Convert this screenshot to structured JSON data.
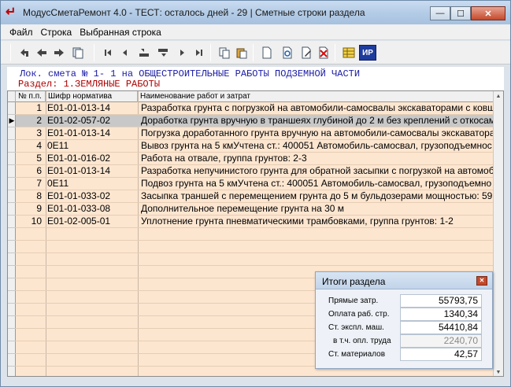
{
  "window": {
    "title": "МодусСметаРемонт 4.0 - ТЕСТ: осталось дней - 29 | Сметные строки раздела",
    "minimize": "—",
    "maximize": "☐",
    "close": "✕"
  },
  "menu": [
    "Файл",
    "Строка",
    "Выбранная строка"
  ],
  "toolbar": {
    "icons": [
      "back-arrow-icon",
      "arrow-left-icon",
      "arrow-right-icon",
      "copy-doc-icon",
      "first-icon",
      "prev-icon",
      "page-prev-icon",
      "page-next-icon",
      "next-icon",
      "last-icon",
      "copy-icon",
      "paste-icon",
      "new-doc-icon",
      "find-doc-icon",
      "edit-doc-icon",
      "delete-doc-icon",
      "table-icon",
      "ip-icon"
    ],
    "ip_label": "ИР"
  },
  "smeta": {
    "line1": "Лок. смета № 1- 1 на ОБЩЕСТРОИТЕЛЬНЫЕ РАБОТЫ ПОДЗЕМНОЙ ЧАСТИ",
    "line2": "Раздел: 1.ЗЕМЛЯНЫЕ РАБОТЫ"
  },
  "grid": {
    "headers": {
      "num": "№ п.п.",
      "code": "Шифр норматива",
      "name": "Наименование работ и затрат"
    },
    "selected_row": 1,
    "rows": [
      {
        "num": "1",
        "code": "Е01-01-013-14",
        "name": "Разработка грунта с погрузкой на автомобили-самосвалы экскаваторами с ковш"
      },
      {
        "num": "2",
        "code": "Е01-02-057-02",
        "name": "Доработка грунта вручную в траншеях глубиной до 2 м без креплений с откосам"
      },
      {
        "num": "3",
        "code": "Е01-01-013-14",
        "name": "Погрузка доработанного грунта вручную на автомобили-самосвалы экскаватора"
      },
      {
        "num": "4",
        "code": "0Е11",
        "name": "Вывоз грунта на 5 кмУчтена ст.: 400051  Автомобиль-самосвал, грузоподъемнос"
      },
      {
        "num": "5",
        "code": "Е01-01-016-02",
        "name": "Работа на отвале, группа грунтов: 2-3"
      },
      {
        "num": "6",
        "code": "Е01-01-013-14",
        "name": "Разработка непучинистого грунта для обратной засыпки с погрузкой на автомоб"
      },
      {
        "num": "7",
        "code": "0Е11",
        "name": "Подвоз грунта на 5 кмУчтена ст.: 400051  Автомобиль-самосвал, грузоподъемно"
      },
      {
        "num": "8",
        "code": "Е01-01-033-02",
        "name": "Засыпка траншей с перемещением грунта до 5 м бульдозерами мощностью: 59"
      },
      {
        "num": "9",
        "code": "Е01-01-033-08",
        "name": "Дополнительное перемещение грунта на 30 м"
      },
      {
        "num": "10",
        "code": "Е01-02-005-01",
        "name": "Уплотнение грунта пневматическими трамбовками, группа грунтов: 1-2"
      }
    ]
  },
  "totals": {
    "title": "Итоги раздела",
    "items": [
      {
        "label": "Прямые затр.",
        "value": "55793,75"
      },
      {
        "label": "Оплата раб. стр.",
        "value": "1340,34"
      },
      {
        "label": "Ст. экспл. маш.",
        "value": "54410,84"
      },
      {
        "label": "в т.ч. опл. труда",
        "value": "2240,70"
      },
      {
        "label": "Ст. материалов",
        "value": "42,57"
      }
    ]
  }
}
